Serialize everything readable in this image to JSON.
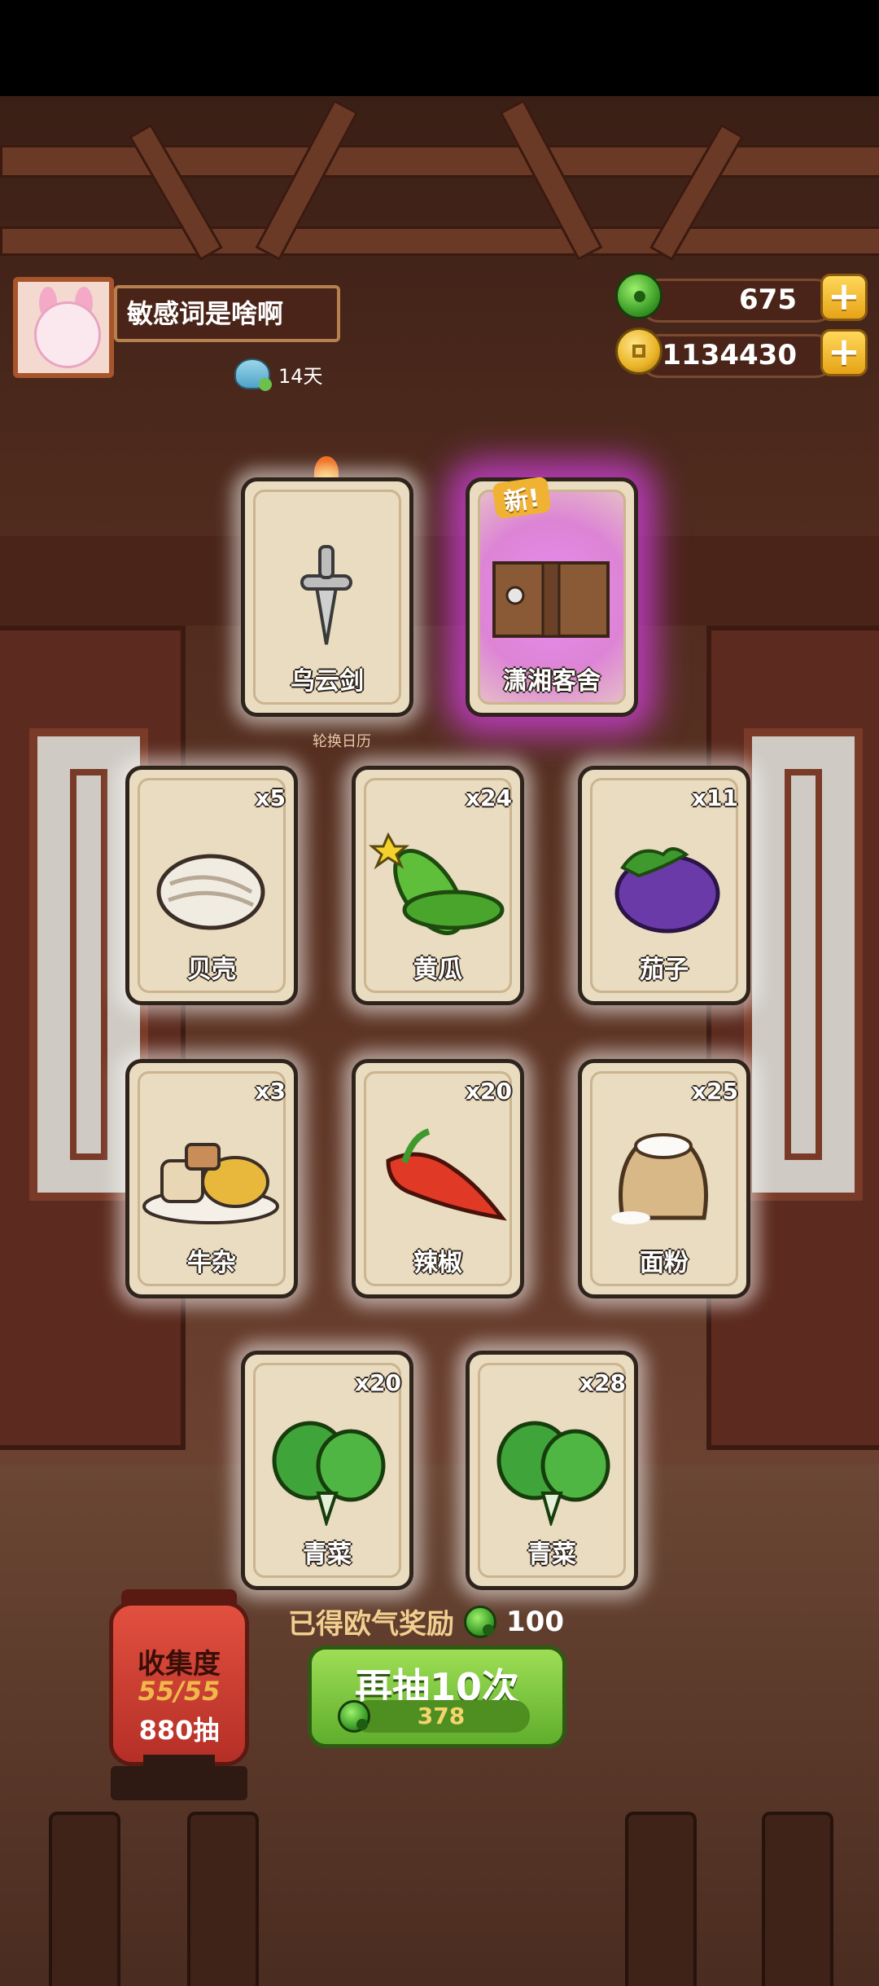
{
  "player": {
    "name": "敏感词是啥啊",
    "days": "14天"
  },
  "resources": {
    "jade": "675",
    "coins": "1134430"
  },
  "top_cards": [
    {
      "label": "乌云剑",
      "new": false
    },
    {
      "label": "潇湘客舍",
      "new": true,
      "new_tag": "新!"
    }
  ],
  "calendar_caption": "轮换日历",
  "item_cards": [
    {
      "label": "贝壳",
      "qty": "x5"
    },
    {
      "label": "黄瓜",
      "qty": "x24"
    },
    {
      "label": "茄子",
      "qty": "x11"
    },
    {
      "label": "牛杂",
      "qty": "x3"
    },
    {
      "label": "辣椒",
      "qty": "x20"
    },
    {
      "label": "面粉",
      "qty": "x25"
    },
    {
      "label": "青菜",
      "qty": "x20"
    },
    {
      "label": "青菜",
      "qty": "x28"
    }
  ],
  "luck_reward": {
    "label": "已得欧气奖励",
    "value": "100"
  },
  "draw_button": {
    "label": "再抽10次",
    "cost": "378"
  },
  "collection": {
    "title": "收集度",
    "progress": "55/55",
    "draws": "880抽"
  },
  "colors": {
    "card_bg": "#eadcc0",
    "new_glow": "#d640e6",
    "button_green": "#6fbf35",
    "lantern_red": "#c83a2f"
  }
}
